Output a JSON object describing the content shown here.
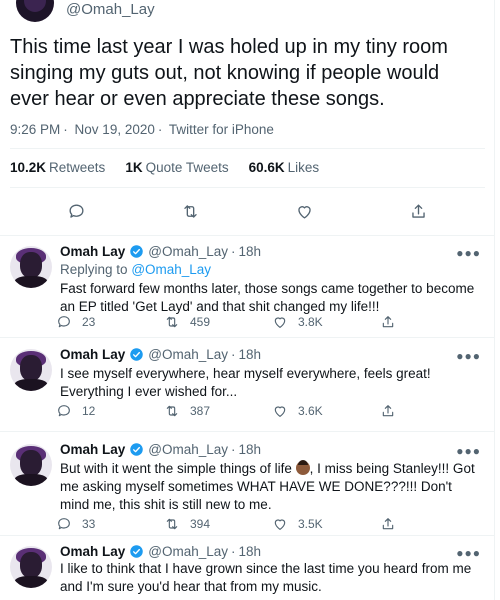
{
  "main_tweet": {
    "handle": "@Omah_Lay",
    "text": "This time last year I was holed up in my tiny room singing my guts out, not knowing if people would ever hear or even appreciate these songs.",
    "time": "9:26 PM",
    "date": "Nov 19, 2020",
    "source": "Twitter for iPhone",
    "retweets_count": "10.2K",
    "retweets_label": "Retweets",
    "quotes_count": "1K",
    "quotes_label": "Quote Tweets",
    "likes_count": "60.6K",
    "likes_label": "Likes"
  },
  "replies": [
    {
      "name": "Omah Lay",
      "handle": "@Omah_Lay",
      "age": "18h",
      "replying_prefix": "Replying to",
      "replying_to": "@Omah_Lay",
      "text": "Fast forward few months later, those songs came together to become an EP titled 'Get Layd' and that shit changed my life!!!",
      "replies": "23",
      "retweets": "459",
      "likes": "3.8K"
    },
    {
      "name": "Omah Lay",
      "handle": "@Omah_Lay",
      "age": "18h",
      "text": "I see myself everywhere, hear myself everywhere, feels great! Everything I ever wished for...",
      "replies": "12",
      "retweets": "387",
      "likes": "3.6K"
    },
    {
      "name": "Omah Lay",
      "handle": "@Omah_Lay",
      "age": "18h",
      "text_before_emoji": "But with it went the simple things of life ",
      "text_after_emoji": ", I miss being Stanley!!! Got me asking myself sometimes WHAT HAVE WE DONE???!!! Don't mind me, this shit is still new to me.",
      "replies": "33",
      "retweets": "394",
      "likes": "3.5K"
    },
    {
      "name": "Omah Lay",
      "handle": "@Omah_Lay",
      "age": "18h",
      "text": "I like to think that I have grown since the last time you heard from me and I'm sure you'd hear that from my music."
    }
  ],
  "icons": {
    "reply": "reply-icon",
    "retweet": "retweet-icon",
    "like": "heart-icon",
    "share": "share-icon",
    "verified": "verified-badge-icon",
    "more": "more-icon"
  },
  "colors": {
    "accent": "#1d9bf0",
    "text": "#0f1419",
    "muted": "#536471"
  }
}
